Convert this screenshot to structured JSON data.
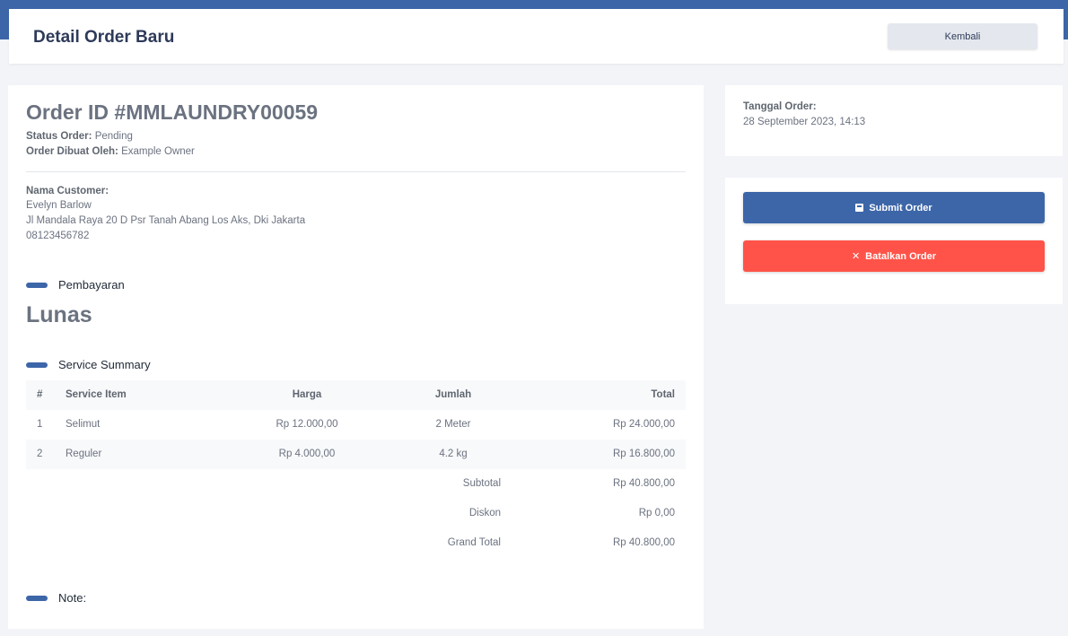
{
  "header": {
    "title": "Detail Order Baru",
    "back_label": "Kembali"
  },
  "order": {
    "id_text": "Order ID #MMLAUNDRY00059",
    "status_label": "Status Order:",
    "status_value": "Pending",
    "created_by_label": "Order Dibuat Oleh:",
    "created_by_value": "Example Owner"
  },
  "customer": {
    "label": "Nama Customer:",
    "name": "Evelyn Barlow",
    "address": "Jl Mandala Raya 20 D Psr Tanah Abang Los Aks, Dki Jakarta",
    "phone": "08123456782"
  },
  "payment": {
    "section_label": "Pembayaran",
    "status": "Lunas"
  },
  "service_summary": {
    "section_label": "Service Summary",
    "columns": [
      "#",
      "Service Item",
      "Harga",
      "Jumlah",
      "Total"
    ],
    "rows": [
      {
        "no": "1",
        "item": "Selimut",
        "harga": "Rp 12.000,00",
        "jumlah": "2 Meter",
        "total": "Rp 24.000,00"
      },
      {
        "no": "2",
        "item": "Reguler",
        "harga": "Rp 4.000,00",
        "jumlah": "4.2 kg",
        "total": "Rp 16.800,00"
      }
    ],
    "subtotal_label": "Subtotal",
    "subtotal_value": "Rp 40.800,00",
    "discount_label": "Diskon",
    "discount_value": "Rp 0,00",
    "grand_total_label": "Grand Total",
    "grand_total_value": "Rp 40.800,00"
  },
  "note": {
    "section_label": "Note:"
  },
  "side": {
    "order_date_label": "Tanggal Order:",
    "order_date_value": "28 September 2023, 14:13",
    "submit_label": "Submit Order",
    "cancel_label": "Batalkan Order",
    "submit_icon": "save-icon",
    "cancel_icon": "close-icon"
  },
  "colors": {
    "primary": "#3d66a9",
    "danger": "#ff5349",
    "background": "#f3f4f8"
  }
}
